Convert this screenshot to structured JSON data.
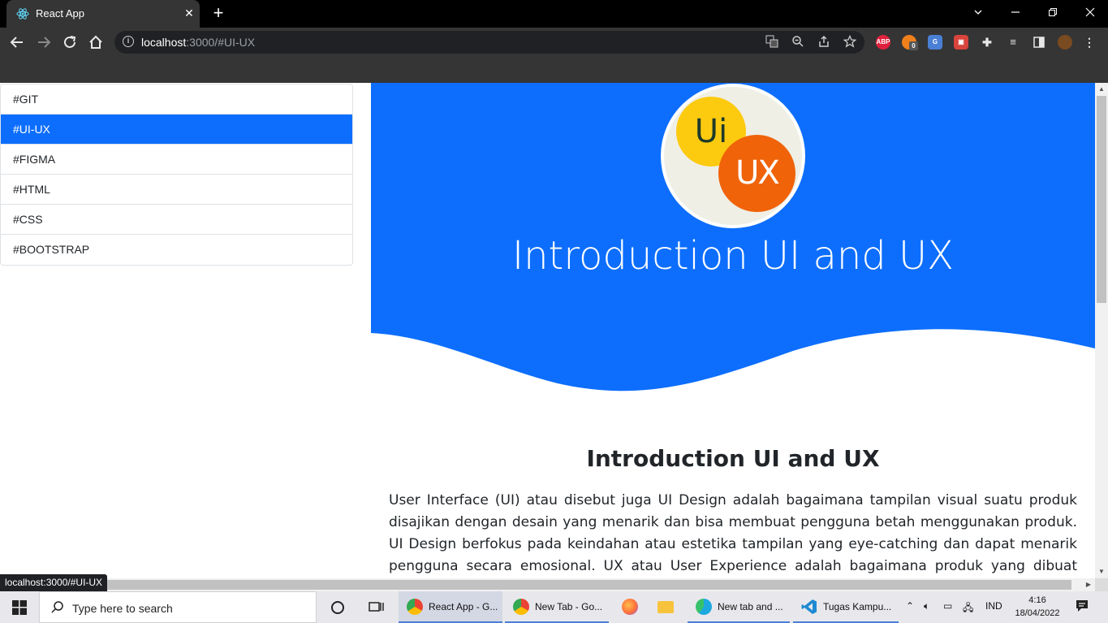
{
  "browser": {
    "tab_title": "React App",
    "new_tab_symbol": "+",
    "url_host": "localhost",
    "url_rest": ":3000/#UI-UX",
    "status_url": "localhost:3000/#UI-UX",
    "extensions": {
      "abp": "ABP",
      "badge": "0"
    }
  },
  "sidebar": {
    "items": [
      {
        "label": "#GIT",
        "active": false
      },
      {
        "label": "#UI-UX",
        "active": true
      },
      {
        "label": "#FIGMA",
        "active": false
      },
      {
        "label": "#HTML",
        "active": false
      },
      {
        "label": "#CSS",
        "active": false
      },
      {
        "label": "#BOOTSTRAP",
        "active": false
      }
    ]
  },
  "hero": {
    "logo_ui": "Ui",
    "logo_ux": "UX",
    "title": "Introduction UI and UX"
  },
  "content": {
    "heading": "Introduction UI and UX",
    "paragraph": "User Interface (UI) atau disebut juga UI Design adalah bagaimana tampilan visual suatu produk disajikan dengan desain yang menarik dan bisa membuat pengguna betah menggunakan produk. UI Design berfokus pada keindahan atau estetika tampilan yang eye-catching dan dapat menarik pengguna secara emosional. UX atau User Experience adalah bagaimana produk yang dibuat dapat dengan mudah"
  },
  "taskbar": {
    "search_placeholder": "Type here to search",
    "apps": [
      {
        "label": "React App - G...",
        "active": true
      },
      {
        "label": "New Tab - Go...",
        "active": false
      },
      {
        "label": "",
        "active": false
      },
      {
        "label": "",
        "active": false
      },
      {
        "label": "New tab and ...",
        "active": false
      },
      {
        "label": "Tugas Kampu...",
        "active": false
      }
    ],
    "language": "IND",
    "time": "4:16",
    "date": "18/04/2022"
  },
  "colors": {
    "accent": "#0d6efd",
    "hero_blue": "#0d6efd",
    "ui_yellow": "#fcca0f",
    "ux_orange": "#f06309"
  }
}
